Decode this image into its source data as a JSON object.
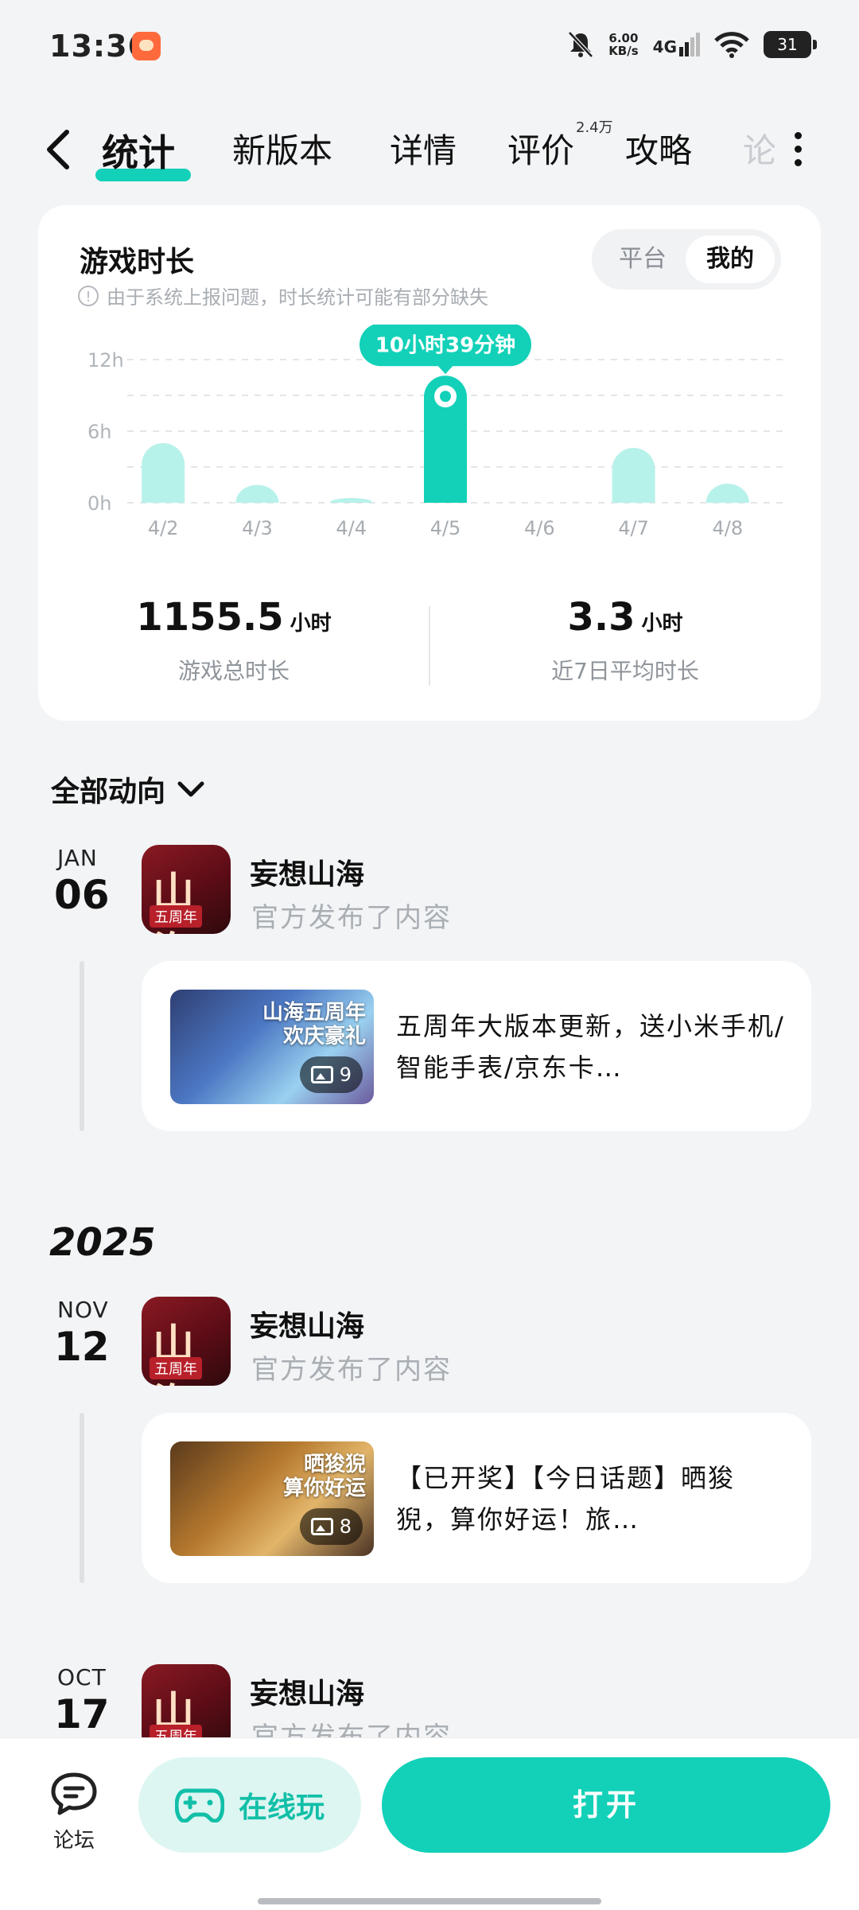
{
  "status_bar": {
    "time": "13:36",
    "net_speed_value": "6.00",
    "net_speed_unit": "KB/s",
    "network": "4G",
    "battery": "31"
  },
  "tabs": [
    {
      "label": "统计"
    },
    {
      "label": "新版本"
    },
    {
      "label": "详情"
    },
    {
      "label": "评价",
      "badge": "2.4万"
    },
    {
      "label": "攻略"
    },
    {
      "label": "论"
    }
  ],
  "stats": {
    "title": "游戏时长",
    "note": "由于系统上报问题，时长统计可能有部分缺失",
    "segment": {
      "off": "平台",
      "on": "我的"
    },
    "chart_data": {
      "type": "bar",
      "categories": [
        "4/2",
        "4/3",
        "4/4",
        "4/5",
        "4/6",
        "4/7",
        "4/8"
      ],
      "values": [
        5.0,
        1.5,
        0.4,
        10.65,
        0,
        4.6,
        1.6
      ],
      "y_ticks": [
        "12h",
        "6h",
        "0h"
      ],
      "ylim": [
        0,
        12
      ],
      "highlight_index": 3,
      "tooltip": "10小时39分钟",
      "grid": true,
      "bar_color": "#b7f2ea",
      "highlight_color": "#12d1b8"
    },
    "total": {
      "value": "1155.5",
      "unit": "小时",
      "label": "游戏总时长"
    },
    "avg": {
      "value": "3.3",
      "unit": "小时",
      "label": "近7日平均时长"
    }
  },
  "feed": {
    "filter_label": "全部动向",
    "entries": [
      {
        "month": "JAN",
        "day": "06",
        "game_name": "妄想山海",
        "subtitle": "官方发布了内容",
        "icon_text": "山海",
        "icon_tag": "五周年",
        "thumb_overlay": "山海五周年\n欢庆豪礼",
        "image_count": "9",
        "post_text": "五周年大版本更新，送小米手机/智能手表/京东卡…"
      },
      {
        "month": "NOV",
        "day": "12",
        "game_name": "妄想山海",
        "subtitle": "官方发布了内容",
        "icon_text": "山海",
        "icon_tag": "五周年",
        "thumb_overlay": "晒狻猊\n算你好运",
        "image_count": "8",
        "post_text": "【已开奖】【今日话题】晒狻猊，算你好运！旅…"
      },
      {
        "month": "OCT",
        "day": "17",
        "game_name": "妄想山海",
        "subtitle": "官方发布了内容",
        "icon_text": "山海",
        "icon_tag": "五周年"
      }
    ],
    "year_label": "2025"
  },
  "bottom_bar": {
    "forum_label": "论坛",
    "play_label": "在线玩",
    "open_label": "打开"
  },
  "colors": {
    "accent": "#12d1b8",
    "background": "#f2f4f6"
  }
}
